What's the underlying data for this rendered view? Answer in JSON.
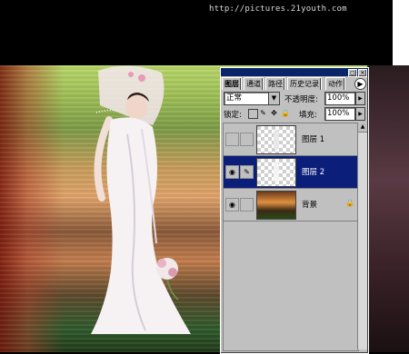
{
  "watermark": "http://pictures.21youth.com",
  "palette": {
    "title_buttons": [
      "▢",
      "✕"
    ],
    "tabs": [
      "图层",
      "通道",
      "路径",
      "历史记录",
      "动作"
    ],
    "blend_mode": "正常",
    "opacity_label": "不透明度:",
    "opacity_value": "100%",
    "lock_label": "锁定:",
    "fill_label": "填充:",
    "fill_value": "100%",
    "layers": [
      {
        "name": "图层 1",
        "visible": false,
        "selected": false
      },
      {
        "name": "图层 2",
        "visible": true,
        "selected": true
      },
      {
        "name": "背景",
        "visible": true,
        "selected": false,
        "locked": true
      }
    ]
  },
  "icons": {
    "menu_arrow": "▶",
    "dropdown": "▼",
    "eye": "◉",
    "brush": "✎",
    "lock": "🔒",
    "scroll_up": "▲"
  },
  "colors": {
    "palette_bg": "#c0c0c0",
    "selected_layer": "#0a1e7a",
    "titlebar": "#0a246a"
  }
}
